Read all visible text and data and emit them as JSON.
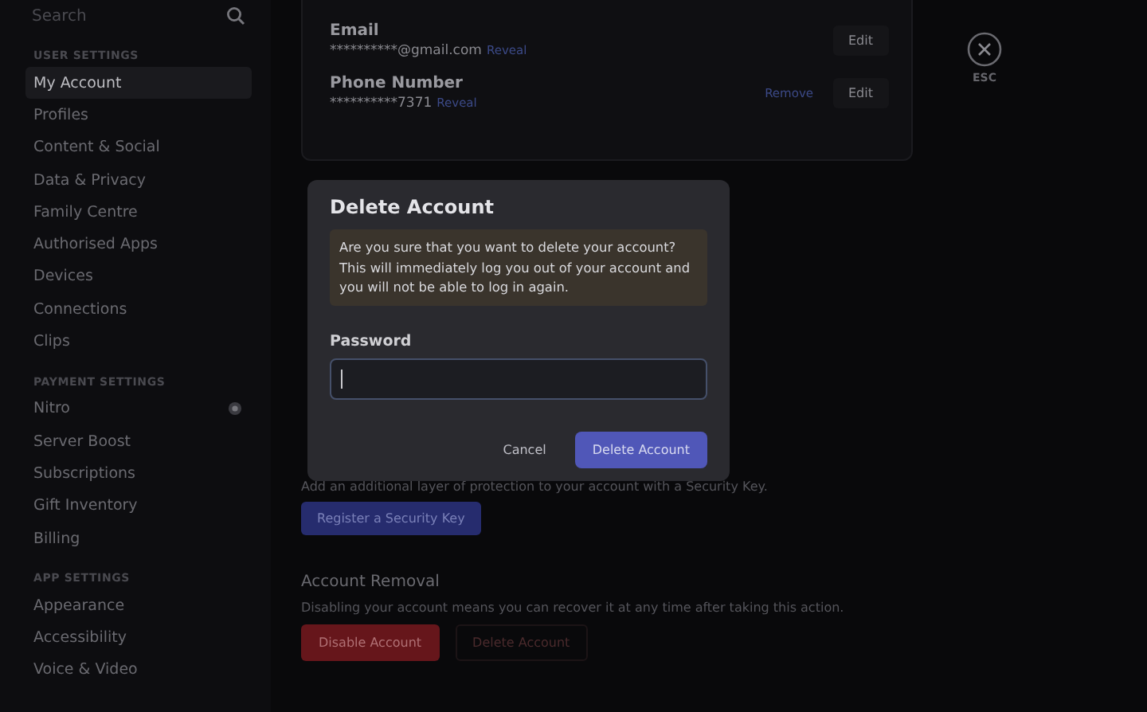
{
  "sidebar": {
    "search": {
      "placeholder": "Search"
    },
    "sections": [
      {
        "header": "USER SETTINGS",
        "items": [
          {
            "label": "My Account",
            "selected": true
          },
          {
            "label": "Profiles",
            "selected": false
          },
          {
            "label": "Content & Social",
            "selected": false
          },
          {
            "label": "Data & Privacy",
            "selected": false
          },
          {
            "label": "Family Centre",
            "selected": false
          },
          {
            "label": "Authorised Apps",
            "selected": false
          },
          {
            "label": "Devices",
            "selected": false
          },
          {
            "label": "Connections",
            "selected": false
          },
          {
            "label": "Clips",
            "selected": false
          }
        ]
      },
      {
        "header": "PAYMENT SETTINGS",
        "items": [
          {
            "label": "Nitro",
            "selected": false,
            "badge": true
          },
          {
            "label": "Server Boost",
            "selected": false
          },
          {
            "label": "Subscriptions",
            "selected": false
          },
          {
            "label": "Gift Inventory",
            "selected": false
          },
          {
            "label": "Billing",
            "selected": false
          }
        ]
      },
      {
        "header": "APP SETTINGS",
        "items": [
          {
            "label": "Appearance",
            "selected": false
          },
          {
            "label": "Accessibility",
            "selected": false
          },
          {
            "label": "Voice & Video",
            "selected": false
          }
        ]
      }
    ]
  },
  "account_card": {
    "fields": [
      {
        "label": "Email",
        "value": "**********@gmail.com",
        "reveal": "Reveal",
        "edit": "Edit"
      },
      {
        "label": "Phone Number",
        "value": "**********7371",
        "reveal": "Reveal",
        "remove": "Remove",
        "edit": "Edit"
      }
    ]
  },
  "close": {
    "label": "ESC"
  },
  "security_key": {
    "description": "Add an additional layer of protection to your account with a Security Key.",
    "button": "Register a Security Key"
  },
  "account_removal": {
    "title": "Account Removal",
    "description": "Disabling your account means you can recover it at any time after taking this action.",
    "buttons": [
      {
        "label": "Disable Account",
        "kind": "filled"
      },
      {
        "label": "Delete Account",
        "kind": "outline"
      }
    ]
  },
  "dialog": {
    "title": "Delete Account",
    "warning": "Are you sure that you want to delete your account? This will immediately log you out of your account and you will not be able to log in again.",
    "password_label": "Password",
    "buttons": [
      {
        "label": "Cancel",
        "kind": "link"
      },
      {
        "label": "Delete Account",
        "kind": "primary"
      }
    ]
  }
}
